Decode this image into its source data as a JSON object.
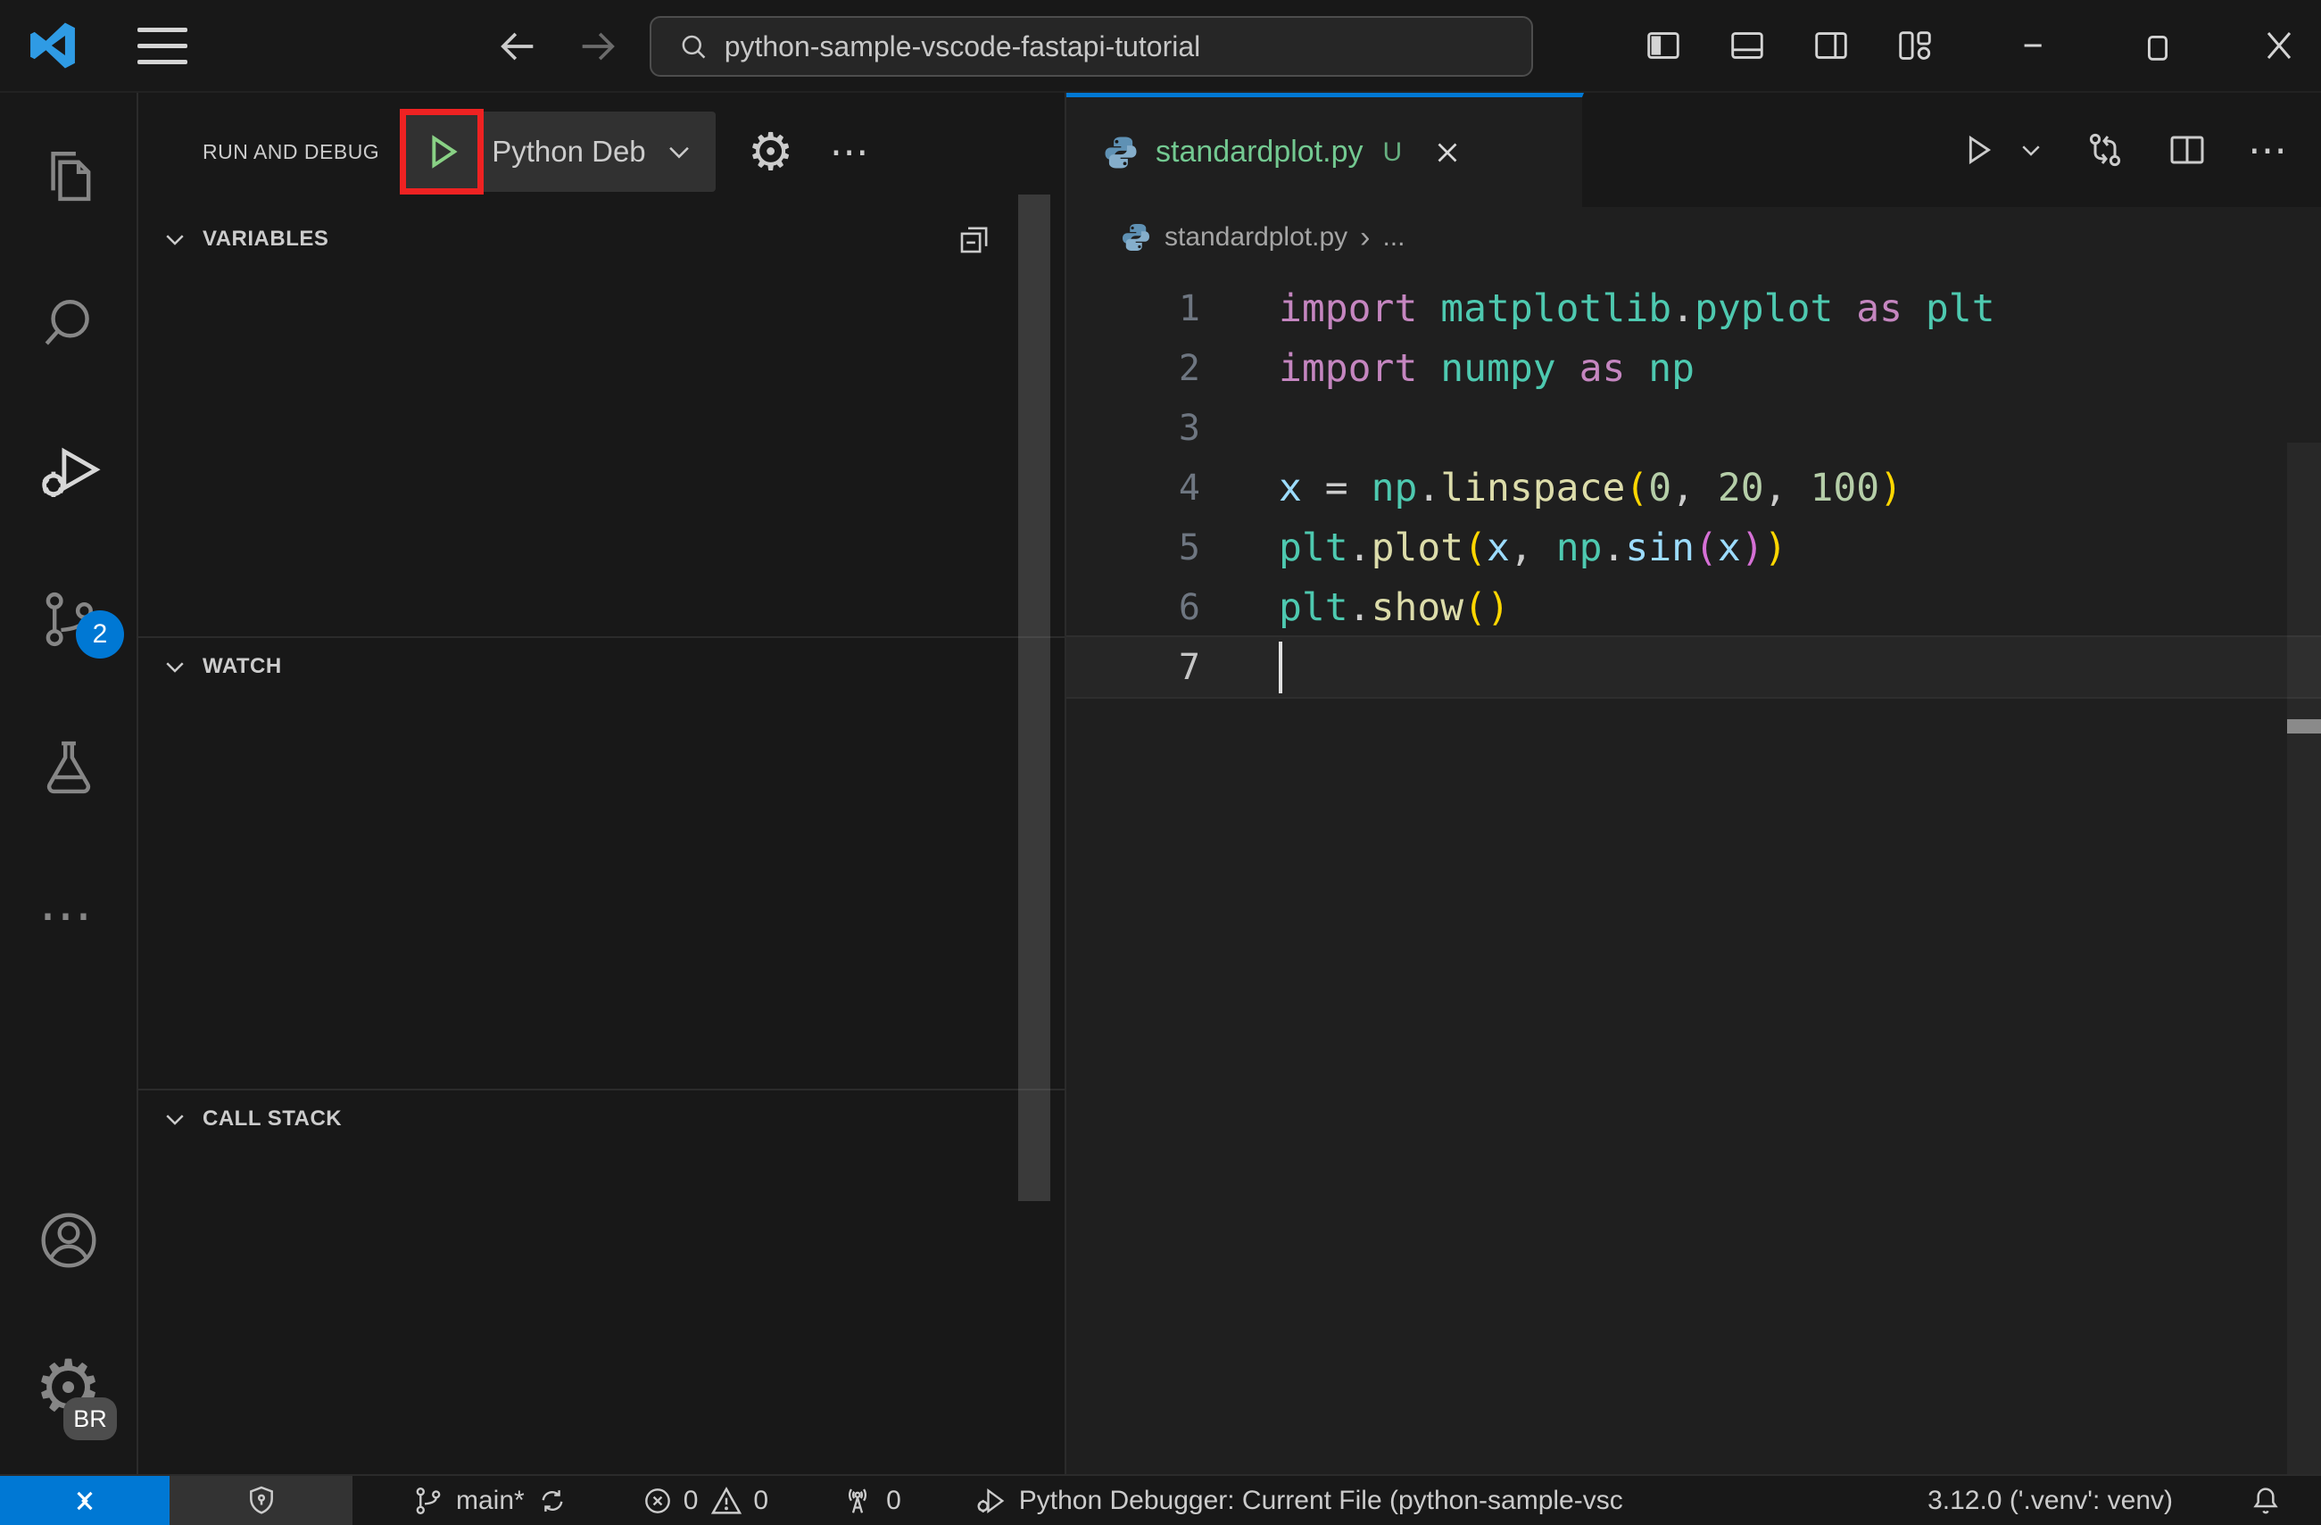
{
  "colors": {
    "accent_blue": "#0078d4",
    "untracked_green": "#73c991",
    "play_green": "#89d185",
    "annotation_red": "#ee2222",
    "remote_blue": "#0078d4"
  },
  "icons": {
    "gear": "⚙",
    "ellipsis": "⋯",
    "ellipsis_small": "…",
    "breadcrumb_chevron": "›"
  },
  "title_bar": {
    "search_value": "python-sample-vscode-fastapi-tutorial"
  },
  "activity_bar": {
    "source_control_badge": "2",
    "profile_badge": "BR"
  },
  "sidebar": {
    "title": "RUN AND DEBUG",
    "debug_config_label": "Python Deb",
    "sections": {
      "variables": "VARIABLES",
      "watch": "WATCH",
      "call_stack": "CALL STACK"
    }
  },
  "editor": {
    "tab": {
      "file_name": "standardplot.py",
      "git_status": "U"
    },
    "breadcrumb": {
      "file_name": "standardplot.py",
      "symbol": "..."
    },
    "code": {
      "colors": {
        "kw": "#C586C0",
        "mod": "#4EC9B0",
        "fn": "#DCDCAA",
        "var": "#9CDCFE",
        "num": "#B5CEA8",
        "pl": "#CCCCCC",
        "b1": "#FFD700",
        "b2": "#D670D6"
      },
      "lines": [
        {
          "n": "1",
          "tokens": [
            {
              "t": "import",
              "c": "kw"
            },
            {
              "t": " ",
              "c": "pl"
            },
            {
              "t": "matplotlib",
              "c": "mod"
            },
            {
              "t": ".",
              "c": "pl"
            },
            {
              "t": "pyplot",
              "c": "mod"
            },
            {
              "t": " ",
              "c": "pl"
            },
            {
              "t": "as",
              "c": "kw"
            },
            {
              "t": " ",
              "c": "pl"
            },
            {
              "t": "plt",
              "c": "mod"
            }
          ]
        },
        {
          "n": "2",
          "tokens": [
            {
              "t": "import",
              "c": "kw"
            },
            {
              "t": " ",
              "c": "pl"
            },
            {
              "t": "numpy",
              "c": "mod"
            },
            {
              "t": " ",
              "c": "pl"
            },
            {
              "t": "as",
              "c": "kw"
            },
            {
              "t": " ",
              "c": "pl"
            },
            {
              "t": "np",
              "c": "mod"
            }
          ]
        },
        {
          "n": "3",
          "tokens": []
        },
        {
          "n": "4",
          "tokens": [
            {
              "t": "x",
              "c": "var"
            },
            {
              "t": " = ",
              "c": "pl"
            },
            {
              "t": "np",
              "c": "mod"
            },
            {
              "t": ".",
              "c": "pl"
            },
            {
              "t": "linspace",
              "c": "fn"
            },
            {
              "t": "(",
              "c": "b1"
            },
            {
              "t": "0",
              "c": "num"
            },
            {
              "t": ", ",
              "c": "pl"
            },
            {
              "t": "20",
              "c": "num"
            },
            {
              "t": ", ",
              "c": "pl"
            },
            {
              "t": "100",
              "c": "num"
            },
            {
              "t": ")",
              "c": "b1"
            }
          ]
        },
        {
          "n": "5",
          "tokens": [
            {
              "t": "plt",
              "c": "mod"
            },
            {
              "t": ".",
              "c": "pl"
            },
            {
              "t": "plot",
              "c": "fn"
            },
            {
              "t": "(",
              "c": "b1"
            },
            {
              "t": "x",
              "c": "var"
            },
            {
              "t": ", ",
              "c": "pl"
            },
            {
              "t": "np",
              "c": "mod"
            },
            {
              "t": ".",
              "c": "pl"
            },
            {
              "t": "sin",
              "c": "var"
            },
            {
              "t": "(",
              "c": "b2"
            },
            {
              "t": "x",
              "c": "var"
            },
            {
              "t": ")",
              "c": "b2"
            },
            {
              "t": ")",
              "c": "b1"
            }
          ]
        },
        {
          "n": "6",
          "tokens": [
            {
              "t": "plt",
              "c": "mod"
            },
            {
              "t": ".",
              "c": "pl"
            },
            {
              "t": "show",
              "c": "fn"
            },
            {
              "t": "(",
              "c": "b1"
            },
            {
              "t": ")",
              "c": "b1"
            }
          ]
        },
        {
          "n": "7",
          "tokens": [],
          "current": true,
          "cursor": true
        }
      ]
    }
  },
  "status_bar": {
    "branch": "main*",
    "errors": "0",
    "warnings": "0",
    "ports": "0",
    "debug_status": "Python Debugger: Current File (python-sample-vsc",
    "interpreter": "3.12.0 ('.venv': venv)"
  }
}
